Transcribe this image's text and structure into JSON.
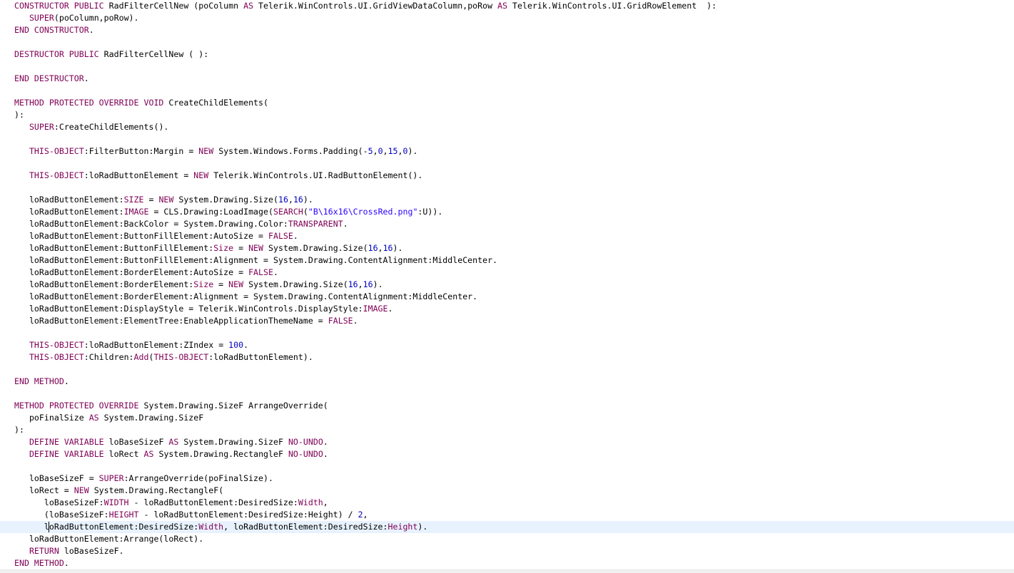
{
  "editor": {
    "current_line_index": 43,
    "lines": [
      [
        [
          "kw",
          "CONSTRUCTOR PUBLIC "
        ],
        [
          "id",
          "RadFilterCellNew (poColumn "
        ],
        [
          "kw",
          "AS"
        ],
        [
          "id",
          " Telerik.WinControls.UI.GridViewDataColumn,poRow "
        ],
        [
          "kw",
          "AS"
        ],
        [
          "id",
          " Telerik.WinControls.UI.GridRowElement  ):"
        ]
      ],
      [
        [
          "id",
          "   "
        ],
        [
          "kw",
          "SUPER"
        ],
        [
          "id",
          "(poColumn,poRow)."
        ]
      ],
      [
        [
          "kw",
          "END CONSTRUCTOR"
        ],
        [
          "id",
          "."
        ]
      ],
      [],
      [
        [
          "kw",
          "DESTRUCTOR PUBLIC "
        ],
        [
          "id",
          "RadFilterCellNew ( ):"
        ]
      ],
      [],
      [
        [
          "kw",
          "END DESTRUCTOR"
        ],
        [
          "id",
          "."
        ]
      ],
      [],
      [
        [
          "kw",
          "METHOD PROTECTED OVERRIDE VOID "
        ],
        [
          "id",
          "CreateChildElements("
        ]
      ],
      [
        [
          "id",
          "):"
        ]
      ],
      [
        [
          "id",
          "   "
        ],
        [
          "kw",
          "SUPER"
        ],
        [
          "id",
          ":CreateChildElements()."
        ]
      ],
      [],
      [
        [
          "id",
          "   "
        ],
        [
          "kw",
          "THIS-OBJECT"
        ],
        [
          "id",
          ":FilterButton:Margin = "
        ],
        [
          "kw",
          "NEW"
        ],
        [
          "id",
          " System.Windows.Forms.Padding(-"
        ],
        [
          "num",
          "5"
        ],
        [
          "id",
          ","
        ],
        [
          "num",
          "0"
        ],
        [
          "id",
          ","
        ],
        [
          "num",
          "15"
        ],
        [
          "id",
          ","
        ],
        [
          "num",
          "0"
        ],
        [
          "id",
          ")."
        ]
      ],
      [],
      [
        [
          "id",
          "   "
        ],
        [
          "kw",
          "THIS-OBJECT"
        ],
        [
          "id",
          ":loRadButtonElement = "
        ],
        [
          "kw",
          "NEW"
        ],
        [
          "id",
          " Telerik.WinControls.UI.RadButtonElement()."
        ]
      ],
      [],
      [
        [
          "id",
          "   loRadButtonElement:"
        ],
        [
          "kw",
          "SIZE"
        ],
        [
          "id",
          " = "
        ],
        [
          "kw",
          "NEW"
        ],
        [
          "id",
          " System.Drawing.Size("
        ],
        [
          "num",
          "16"
        ],
        [
          "id",
          ","
        ],
        [
          "num",
          "16"
        ],
        [
          "id",
          ")."
        ]
      ],
      [
        [
          "id",
          "   loRadButtonElement:"
        ],
        [
          "kw",
          "IMAGE"
        ],
        [
          "id",
          " = CLS.Drawing:LoadImage("
        ],
        [
          "kw",
          "SEARCH"
        ],
        [
          "id",
          "("
        ],
        [
          "str",
          "\"B\\16x16\\CrossRed.png\""
        ],
        [
          "id",
          ":U))."
        ]
      ],
      [
        [
          "id",
          "   loRadButtonElement:BackColor = System.Drawing.Color:"
        ],
        [
          "kw",
          "TRANSPARENT"
        ],
        [
          "id",
          "."
        ]
      ],
      [
        [
          "id",
          "   loRadButtonElement:ButtonFillElement:AutoSize = "
        ],
        [
          "kw",
          "FALSE"
        ],
        [
          "id",
          "."
        ]
      ],
      [
        [
          "id",
          "   loRadButtonElement:ButtonFillElement:"
        ],
        [
          "kw",
          "Size"
        ],
        [
          "id",
          " = "
        ],
        [
          "kw",
          "NEW"
        ],
        [
          "id",
          " System.Drawing.Size("
        ],
        [
          "num",
          "16"
        ],
        [
          "id",
          ","
        ],
        [
          "num",
          "16"
        ],
        [
          "id",
          ")."
        ]
      ],
      [
        [
          "id",
          "   loRadButtonElement:ButtonFillElement:Alignment = System.Drawing.ContentAlignment:MiddleCenter."
        ]
      ],
      [
        [
          "id",
          "   loRadButtonElement:BorderElement:AutoSize = "
        ],
        [
          "kw",
          "FALSE"
        ],
        [
          "id",
          "."
        ]
      ],
      [
        [
          "id",
          "   loRadButtonElement:BorderElement:"
        ],
        [
          "kw",
          "Size"
        ],
        [
          "id",
          " = "
        ],
        [
          "kw",
          "NEW"
        ],
        [
          "id",
          " System.Drawing.Size("
        ],
        [
          "num",
          "16"
        ],
        [
          "id",
          ","
        ],
        [
          "num",
          "16"
        ],
        [
          "id",
          ")."
        ]
      ],
      [
        [
          "id",
          "   loRadButtonElement:BorderElement:Alignment = System.Drawing.ContentAlignment:MiddleCenter."
        ]
      ],
      [
        [
          "id",
          "   loRadButtonElement:DisplayStyle = Telerik.WinControls.DisplayStyle:"
        ],
        [
          "kw",
          "IMAGE"
        ],
        [
          "id",
          "."
        ]
      ],
      [
        [
          "id",
          "   loRadButtonElement:ElementTree:EnableApplicationThemeName = "
        ],
        [
          "kw",
          "FALSE"
        ],
        [
          "id",
          "."
        ]
      ],
      [],
      [
        [
          "id",
          "   "
        ],
        [
          "kw",
          "THIS-OBJECT"
        ],
        [
          "id",
          ":loRadButtonElement:ZIndex = "
        ],
        [
          "num",
          "100"
        ],
        [
          "id",
          "."
        ]
      ],
      [
        [
          "id",
          "   "
        ],
        [
          "kw",
          "THIS-OBJECT"
        ],
        [
          "id",
          ":Children:"
        ],
        [
          "kw",
          "Add"
        ],
        [
          "id",
          "("
        ],
        [
          "kw",
          "THIS-OBJECT"
        ],
        [
          "id",
          ":loRadButtonElement)."
        ]
      ],
      [],
      [
        [
          "kw",
          "END METHOD"
        ],
        [
          "id",
          "."
        ]
      ],
      [],
      [
        [
          "kw",
          "METHOD PROTECTED OVERRIDE "
        ],
        [
          "id",
          "System.Drawing.SizeF ArrangeOverride("
        ]
      ],
      [
        [
          "id",
          "   poFinalSize "
        ],
        [
          "kw",
          "AS"
        ],
        [
          "id",
          " System.Drawing.SizeF"
        ]
      ],
      [
        [
          "id",
          "):"
        ]
      ],
      [
        [
          "id",
          "   "
        ],
        [
          "kw",
          "DEFINE VARIABLE "
        ],
        [
          "id",
          "loBaseSizeF "
        ],
        [
          "kw",
          "AS"
        ],
        [
          "id",
          " System.Drawing.SizeF "
        ],
        [
          "kw",
          "NO-UNDO"
        ],
        [
          "id",
          "."
        ]
      ],
      [
        [
          "id",
          "   "
        ],
        [
          "kw",
          "DEFINE VARIABLE "
        ],
        [
          "id",
          "loRect "
        ],
        [
          "kw",
          "AS"
        ],
        [
          "id",
          " System.Drawing.RectangleF "
        ],
        [
          "kw",
          "NO-UNDO"
        ],
        [
          "id",
          "."
        ]
      ],
      [],
      [
        [
          "id",
          "   loBaseSizeF = "
        ],
        [
          "kw",
          "SUPER"
        ],
        [
          "id",
          ":ArrangeOverride(poFinalSize)."
        ]
      ],
      [
        [
          "id",
          "   loRect = "
        ],
        [
          "kw",
          "NEW"
        ],
        [
          "id",
          " System.Drawing.RectangleF("
        ]
      ],
      [
        [
          "id",
          "      loBaseSizeF:"
        ],
        [
          "kw",
          "WIDTH"
        ],
        [
          "id",
          " - loRadButtonElement:DesiredSize:"
        ],
        [
          "kw",
          "Width"
        ],
        [
          "id",
          ","
        ]
      ],
      [
        [
          "id",
          "      (loBaseSizeF:"
        ],
        [
          "kw",
          "HEIGHT"
        ],
        [
          "id",
          " - loRadButtonElement:DesiredSize:Height) / "
        ],
        [
          "num",
          "2"
        ],
        [
          "id",
          ","
        ]
      ],
      [
        [
          "id",
          "      loRadButtonElement:DesiredSize:"
        ],
        [
          "kw",
          "Width"
        ],
        [
          "id",
          ", loRadButtonElement:DesiredSize:"
        ],
        [
          "kw",
          "Height"
        ],
        [
          "id",
          ")."
        ]
      ],
      [
        [
          "id",
          "   loRadButtonElement:Arrange(loRect)."
        ]
      ],
      [
        [
          "id",
          "   "
        ],
        [
          "kw",
          "RETURN"
        ],
        [
          "id",
          " loBaseSizeF."
        ]
      ],
      [
        [
          "kw",
          "END METHOD"
        ],
        [
          "id",
          "."
        ]
      ]
    ]
  }
}
